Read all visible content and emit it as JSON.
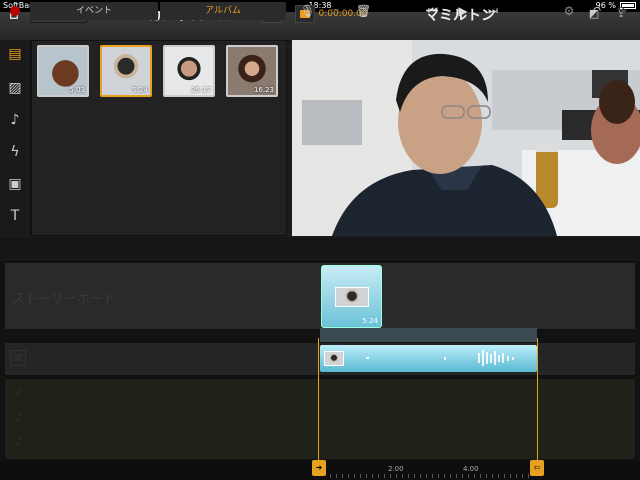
{
  "status_bar": {
    "carrier": "SoftBank",
    "time": "18:38",
    "battery": "96 %"
  },
  "toolbar": {
    "back_label": "アルバム",
    "media_title": "カメラロール",
    "timecode": "0:00:00.00",
    "project_title": "マミルトン"
  },
  "media": {
    "thumbnails": [
      {
        "duration": "5.03",
        "selected": false
      },
      {
        "duration": "5.24",
        "selected": true
      },
      {
        "duration": "25.17",
        "selected": false
      },
      {
        "duration": "16.23",
        "selected": false
      }
    ]
  },
  "tabs": {
    "event": "イベント",
    "album": "アルバム"
  },
  "timeline": {
    "storyboard_label": "ストーリーボード",
    "clip_duration": "5.24",
    "ruler": [
      "2.00",
      "4.00"
    ]
  },
  "colors": {
    "accent": "#e8a020",
    "clip": "#7ccbe0"
  }
}
